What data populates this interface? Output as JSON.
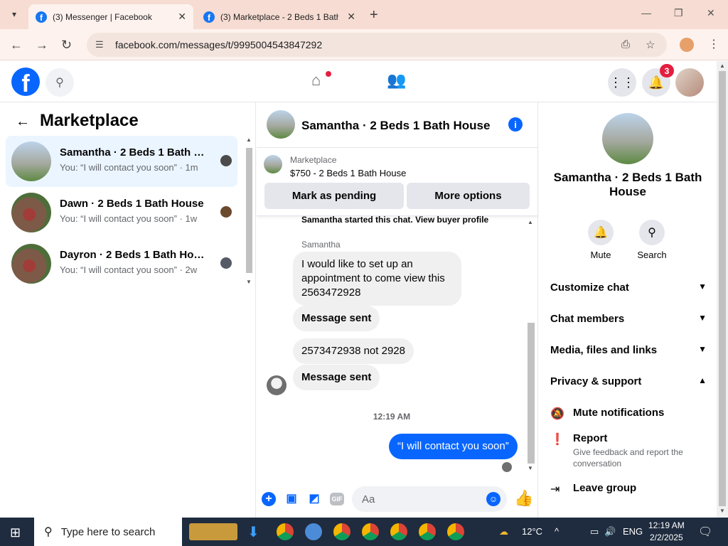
{
  "browser": {
    "tabs": [
      {
        "title": "(3) Messenger | Facebook",
        "active": true
      },
      {
        "title": "(3) Marketplace - 2 Beds 1 Bath",
        "active": false
      }
    ],
    "url": "facebook.com/messages/t/9995004543847292"
  },
  "fb": {
    "notifications_badge": "3"
  },
  "left": {
    "title": "Marketplace",
    "conversations": [
      {
        "name": "Samantha · 2 Beds 1 Bath Ho...",
        "preview": "You: “I will contact you soon” · 1m"
      },
      {
        "name": "Dawn · 2 Beds 1 Bath House",
        "preview": "You: “I will contact you soon” · 1w"
      },
      {
        "name": "Dayron · 2 Beds 1 Bath House",
        "preview": "You: “I will contact you soon” · 2w"
      }
    ]
  },
  "chat": {
    "title": "Samantha · 2 Beds 1 Bath House",
    "listing": {
      "category": "Marketplace",
      "price_line": "$750 - 2 Beds 1 Bath House",
      "btn_pending": "Mark as pending",
      "btn_more": "More options"
    },
    "started_text": "Samantha started this chat.",
    "view_profile": "View buyer profile",
    "sender": "Samantha",
    "messages": [
      "I would like to set up an appointment to come view this 2563472928",
      "Message sent",
      "2573472938 not 2928",
      "Message sent"
    ],
    "timestamp": "12:19 AM",
    "my_message": "“I will contact you soon”",
    "composer_placeholder": "Aa",
    "gif_label": "GIF"
  },
  "right": {
    "name": "Samantha · 2 Beds 1 Bath House",
    "actions": [
      "Mute",
      "Search"
    ],
    "sections": [
      "Customize chat",
      "Chat members",
      "Media, files and links",
      "Privacy & support"
    ],
    "items": [
      {
        "label": "Mute notifications",
        "desc": ""
      },
      {
        "label": "Report",
        "desc": "Give feedback and report the conversation"
      },
      {
        "label": "Leave group",
        "desc": ""
      }
    ]
  },
  "taskbar": {
    "search_placeholder": "Type here to search",
    "weather": "12°C",
    "lang": "ENG",
    "time": "12:19 AM",
    "date": "2/2/2025"
  },
  "colors": {
    "accent": "#0866ff",
    "tabbar": "#f6dcd2",
    "active_conv": "#ebf5ff",
    "badge": "#e41e3f"
  }
}
